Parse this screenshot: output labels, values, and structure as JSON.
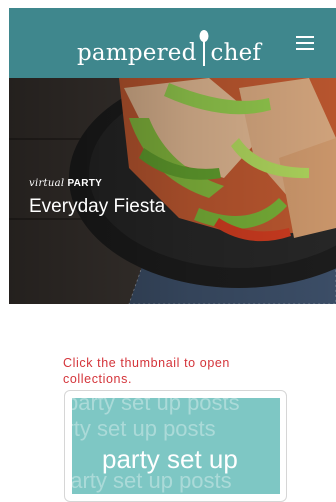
{
  "header": {
    "logo_left": "pampered",
    "logo_right": "chef",
    "menu_icon": "hamburger-menu-icon",
    "color": "#3f878d"
  },
  "hero": {
    "kicker_italic": "virtual",
    "kicker_bold": "PARTY",
    "title": "Everyday Fiesta"
  },
  "content": {
    "instruction": "Click the thumbnail to open collections.",
    "instruction_color": "#d4343a"
  },
  "thumbnail": {
    "main_text": "party set up",
    "background_text": "party set up posts",
    "color": "#7ec7c4"
  }
}
